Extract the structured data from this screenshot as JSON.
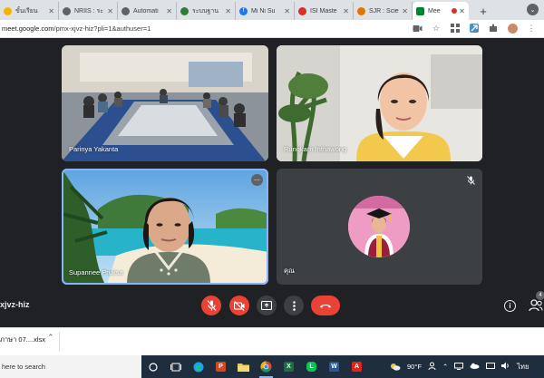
{
  "browser": {
    "tabs": [
      {
        "title": "ขั้นเรียน",
        "favicon_color": "#f4b400",
        "favicon_icon": "document-icon"
      },
      {
        "title": "NRIIS : ระ",
        "favicon_color": "#5f6368",
        "favicon_icon": "globe-icon"
      },
      {
        "title": "Automati",
        "favicon_color": "#5f6368",
        "favicon_icon": "globe-icon"
      },
      {
        "title": "ระบบฐาน",
        "favicon_color": "#2e7d32",
        "favicon_icon": "site-icon"
      },
      {
        "title": "Mi Ni Su",
        "favicon_color": "#1877f2",
        "favicon_icon": "facebook-icon"
      },
      {
        "title": "ISI Maste",
        "favicon_color": "#d93025",
        "favicon_icon": "document-icon"
      },
      {
        "title": "SJR : Scie",
        "favicon_color": "#e37400",
        "favicon_icon": "document-icon"
      },
      {
        "title": "Mee",
        "favicon_color": "#00832d",
        "favicon_icon": "meet-icon",
        "active": true
      }
    ],
    "url_host": "meet.google.com",
    "url_path": "/pmx-xjvz-hiz?pli=1&authuser=1"
  },
  "meet": {
    "tiles": {
      "room": {
        "name": "Parinya Yakanta"
      },
      "rungkarn": {
        "name": "Rungkarn Inthawong"
      },
      "supannee": {
        "name": "Supannee Pruksa"
      },
      "khun": {
        "name": "คุณ"
      }
    },
    "meeting_code": "xjvz-hiz",
    "people_count": "4",
    "accent_red": "#ea4335",
    "active_speaker_outline": "#8ab4f8"
  },
  "downloads": {
    "item_label": "ภาษา 07....xlsx"
  },
  "taskbar": {
    "search_placeholder": "here to search",
    "weather": "90°F",
    "language": "ไทย",
    "apps": [
      {
        "icon": "powerpoint-icon",
        "color": "#d24726",
        "glyph": "P"
      },
      {
        "icon": "excel-icon",
        "color": "#1d6f42",
        "glyph": "X"
      },
      {
        "icon": "line-icon",
        "color": "#06c755",
        "glyph": "L"
      },
      {
        "icon": "word-icon",
        "color": "#2b579a",
        "glyph": "W"
      },
      {
        "icon": "acrobat-icon",
        "color": "#e0241b",
        "glyph": "A"
      }
    ]
  }
}
